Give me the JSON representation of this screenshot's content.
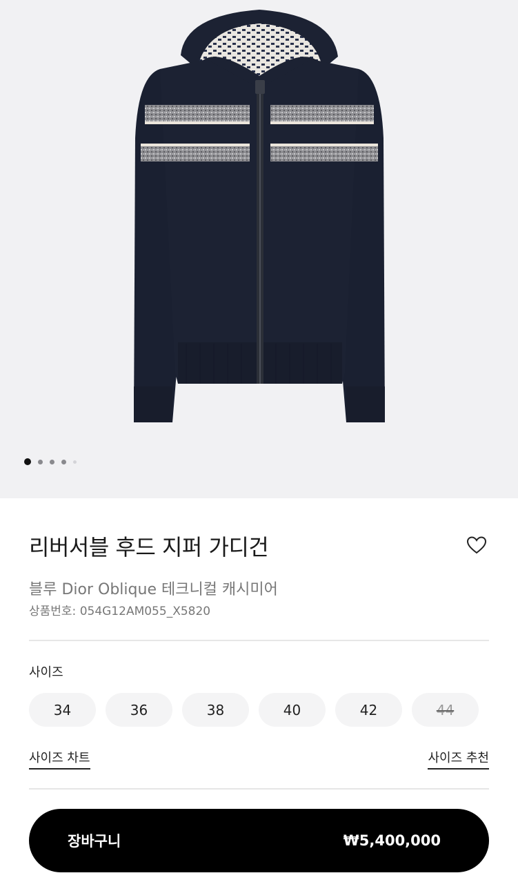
{
  "gallery": {
    "image_alt": "reversible hooded zip cardigan",
    "dots_count": 5,
    "active_dot": 0
  },
  "product": {
    "title": "리버서블 후드 지퍼 가디건",
    "subtitle": "블루 Dior Oblique 테크니컬 캐시미어",
    "sku": "상품번호: 054G12AM055_X5820",
    "wishlist_icon": "heart-outline-icon"
  },
  "size_section": {
    "label": "사이즈",
    "options": [
      {
        "value": "34",
        "available": true
      },
      {
        "value": "36",
        "available": true
      },
      {
        "value": "38",
        "available": true
      },
      {
        "value": "40",
        "available": true
      },
      {
        "value": "42",
        "available": true
      },
      {
        "value": "44",
        "available": false
      }
    ],
    "chart_link": "사이즈 차트",
    "recommend_link": "사이즈 추천"
  },
  "cart": {
    "label": "장바구니",
    "price": "₩5,400,000"
  },
  "colors": {
    "hero_bg": "#f1f1f3",
    "knit": "#1c2233",
    "button": "#000000"
  }
}
